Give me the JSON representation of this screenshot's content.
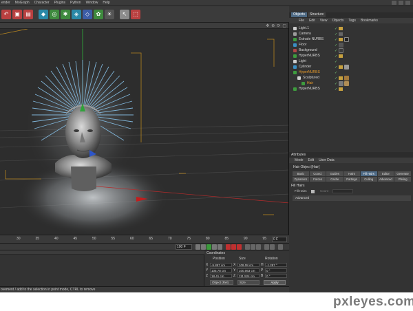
{
  "menubar": {
    "items": [
      "ender",
      "MoGraph",
      "Character",
      "Plugins",
      "Python",
      "Window",
      "Help"
    ]
  },
  "toolbar": {
    "icons": [
      "undo-icon",
      "render-icon",
      "render-settings-icon",
      "cube-icon",
      "nurbs-icon",
      "array-icon",
      "deformer-icon",
      "scene-icon",
      "camera-icon",
      "light-icon",
      "tag-icon",
      "select-icon",
      "live-select-icon"
    ]
  },
  "viewport": {
    "icons": [
      "move-view-icon",
      "zoom-view-icon",
      "rotate-view-icon",
      "maximize-icon"
    ]
  },
  "timeline": {
    "ticks": [
      "30",
      "35",
      "40",
      "45",
      "50",
      "55",
      "60",
      "65",
      "70",
      "75",
      "80",
      "85",
      "90",
      "95"
    ],
    "frame": "0 F"
  },
  "transport": {
    "max_frame": "100 F"
  },
  "coordinates": {
    "title": "Coordinates",
    "col_position": "Position",
    "col_size": "Size",
    "col_rotation": "Rotation",
    "rows": [
      {
        "axis": "X",
        "position": "-5.857 cm",
        "size_axis": "X",
        "size": "108.08 cm",
        "rot_axis": "H",
        "rotation": "-1.287 °"
      },
      {
        "axis": "Y",
        "position": "105.78 cm",
        "size_axis": "Y",
        "size": "100.063 cm",
        "rot_axis": "P",
        "rotation": "0 °"
      },
      {
        "axis": "Z",
        "position": "18.41 cm",
        "size_axis": "Z",
        "size": "111.524 cm",
        "rot_axis": "B",
        "rotation": "0 °"
      }
    ],
    "mode": "Object (Rel)",
    "size_mode": "Size",
    "apply": "Apply"
  },
  "statusbar": {
    "text": "ovement / add to the selection in point mode, CTRL to remove"
  },
  "objects_manager": {
    "tabs": [
      "Objects",
      "Structure"
    ],
    "menu": [
      "File",
      "Edit",
      "View",
      "Objects",
      "Tags",
      "Bookmarks"
    ],
    "rows": [
      {
        "name": "Light.1",
        "highlight": false
      },
      {
        "name": "Camera",
        "highlight": false
      },
      {
        "name": "Extrude NURBS",
        "highlight": false
      },
      {
        "name": "Floor",
        "highlight": false
      },
      {
        "name": "Background",
        "highlight": false
      },
      {
        "name": "HyperNURBS",
        "highlight": false
      },
      {
        "name": "Light",
        "highlight": false
      },
      {
        "name": "Cylinder",
        "highlight": false
      },
      {
        "name": "HyperNURBS",
        "highlight": true
      },
      {
        "name": "Sculptured",
        "highlight": false
      },
      {
        "name": "Hair",
        "highlight": true
      },
      {
        "name": "HyperNURBS",
        "highlight": false
      }
    ]
  },
  "attributes": {
    "title": "Attributes",
    "menu": [
      "Mode",
      "Edit",
      "User Data"
    ],
    "object": "Hair Object [Hair]",
    "tabs_row1": [
      "Basic",
      "Coord.",
      "Guides",
      "Hairs",
      "Fill Hairs",
      "Editor",
      "Generate"
    ],
    "tabs_row2": [
      "Dynamics",
      "Forces",
      "Cache",
      "Partings",
      "Culling",
      "Advanced",
      "Pfeling"
    ],
    "active_tab": "Fill Hairs",
    "section": "Fill Hairs",
    "field_label": "Fill Hairs",
    "field_label2": "Count",
    "advanced": "Advanced"
  },
  "watermark": "pxleyes.com",
  "colors": {
    "accent_tab": "#4e6a85",
    "highlight_text": "#e89b2a",
    "viewport_bg": "#2d2d2d",
    "panel_bg": "#333333"
  }
}
